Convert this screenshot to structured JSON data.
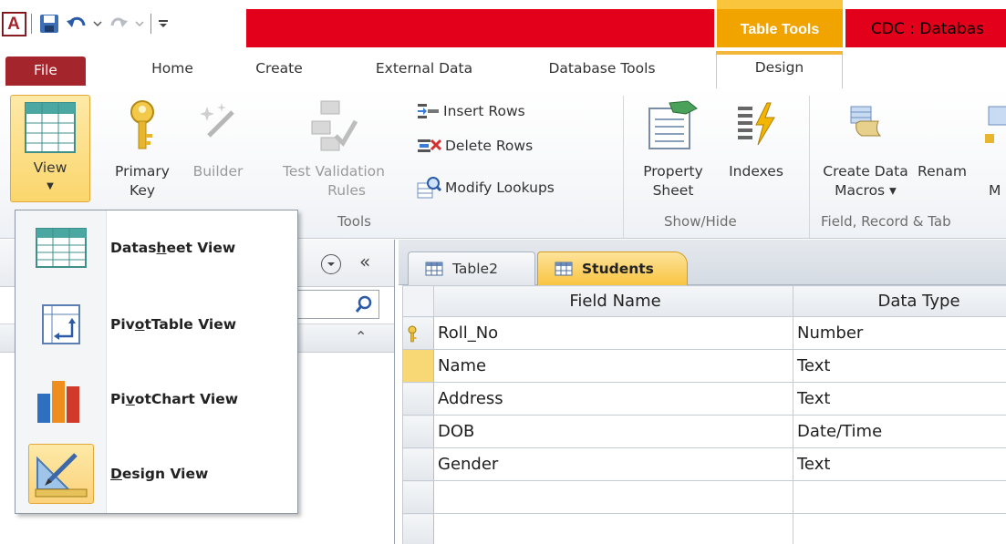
{
  "title_bar": {
    "app_icon_letter": "A",
    "contextual_group": "Table Tools",
    "document_title": "CDC : Databas"
  },
  "tabs": {
    "file": "File",
    "home": "Home",
    "create": "Create",
    "external_data": "External Data",
    "database_tools": "Database Tools",
    "design": "Design"
  },
  "ribbon": {
    "view": "View",
    "primary_key": [
      "Primary",
      "Key"
    ],
    "builder": "Builder",
    "test_validation": [
      "Test Validation",
      "Rules"
    ],
    "insert_rows": "Insert Rows",
    "delete_rows": "Delete Rows",
    "modify_lookups": "Modify Lookups",
    "tools_group": "Tools",
    "property_sheet": [
      "Property",
      "Sheet"
    ],
    "indexes": "Indexes",
    "show_hide_group": "Show/Hide",
    "create_data_macros": [
      "Create Data",
      "Macros ▾"
    ],
    "rename_macro": [
      "Renam",
      "M"
    ],
    "field_record_group": "Field, Record & Tab"
  },
  "view_menu": {
    "items": [
      {
        "pre": "Datas",
        "key": "h",
        "post": "eet View"
      },
      {
        "pre": "Piv",
        "key": "o",
        "post": "tTable View"
      },
      {
        "pre": "Pi",
        "key": "v",
        "post": "otChart View"
      },
      {
        "pre": "",
        "key": "D",
        "post": "esign View"
      }
    ]
  },
  "doc_tabs": {
    "table2": "Table2",
    "students": "Students"
  },
  "grid": {
    "headers": [
      "Field Name",
      "Data Type"
    ],
    "rows": [
      {
        "field": "Roll_No",
        "type": "Number"
      },
      {
        "field": "Name",
        "type": "Text"
      },
      {
        "field": "Address",
        "type": "Text"
      },
      {
        "field": "DOB",
        "type": "Date/Time"
      },
      {
        "field": "Gender",
        "type": "Text"
      },
      {
        "field": "",
        "type": ""
      },
      {
        "field": "",
        "type": ""
      }
    ]
  }
}
